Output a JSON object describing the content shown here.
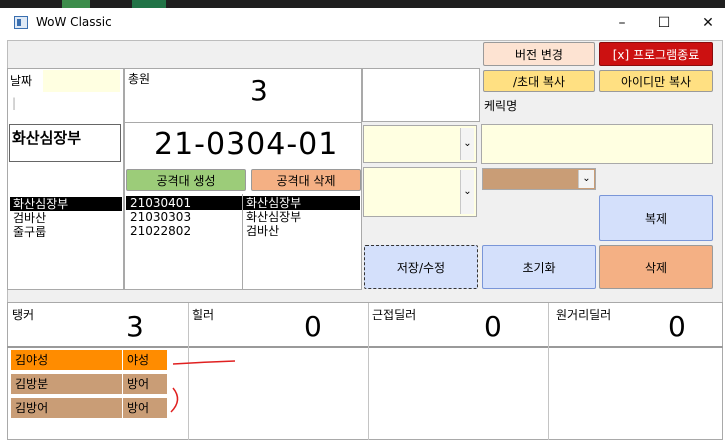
{
  "window": {
    "title": "WoW Classic",
    "minimize": "–",
    "maximize": "☐",
    "close": "✕"
  },
  "colors": {
    "yellow": "#ffffe1",
    "header_yellow": "#ffe082",
    "green": "#9ccc79",
    "salmon": "#f4b084",
    "red": "#cc1111",
    "blue": "#d4e0fb",
    "tan": "#c99d76",
    "orange": "#ff8c00"
  },
  "header": {
    "version_button": "버전 변경",
    "exit_button": "[x] 프로그램종료"
  },
  "date": {
    "label": "날짜",
    "value": "",
    "sub": "|"
  },
  "members": {
    "label": "총원",
    "count": "3"
  },
  "raid": {
    "leader": "화산심장부",
    "code": "21-0304-01",
    "create_button": "공격대 생성",
    "delete_button": "공격대 삭제",
    "dungeons": [
      "화산심장부",
      "검바산",
      "줄구룹"
    ],
    "ids": [
      "21030401",
      "21030303",
      "21022802"
    ],
    "names": [
      "화산심장부",
      "화산심장부",
      "검바산"
    ]
  },
  "actions": {
    "invite_copy": "/초대 복사",
    "id_copy": "아이디만 복사",
    "char_label": "케릭명",
    "duplicate": "복제",
    "save": "저장/수정",
    "reset": "초기화",
    "delete": "삭제"
  },
  "roles": [
    {
      "label": "탱커",
      "count": "3"
    },
    {
      "label": "힐러",
      "count": "0"
    },
    {
      "label": "근접딜러",
      "count": "0"
    },
    {
      "label": "원거리딜러",
      "count": "0"
    }
  ],
  "tanks": [
    {
      "name": "김야성",
      "spec": "야성"
    },
    {
      "name": "김방분",
      "spec": "방어"
    },
    {
      "name": "김방어",
      "spec": "방어"
    }
  ]
}
